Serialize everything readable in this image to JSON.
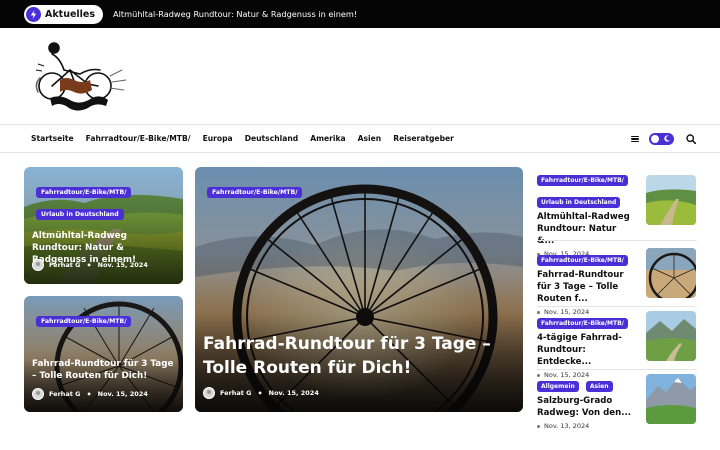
{
  "ticker": {
    "label": "Aktuelles",
    "headline": "Altmühltal-Radweg Rundtour: Natur & Radgenuss in einem!"
  },
  "nav": {
    "items": [
      "Startseite",
      "Fahrradtour/E-Bike/MTB/",
      "Europa",
      "Deutschland",
      "Amerika",
      "Asien",
      "Reiseratgeber"
    ]
  },
  "colors": {
    "accent": "#4b2fd6",
    "ticker_bg": "#050505"
  },
  "cards": [
    {
      "tags": [
        "Fahrradtour/E-Bike/MTB/",
        "Urlaub in Deutschland"
      ],
      "title": "Altmühltal-Radweg Rundtour: Natur & Radgenuss in einem!",
      "author": "Ferhat G",
      "date": "Nov. 15, 2024"
    },
    {
      "tags": [
        "Fahrradtour/E-Bike/MTB/"
      ],
      "title": "Fahrrad-Rundtour für 3 Tage – Tolle Routen für Dich!",
      "author": "Ferhat G",
      "date": "Nov. 15, 2024"
    },
    {
      "tags": [
        "Fahrradtour/E-Bike/MTB/"
      ],
      "title": "Fahrrad-Rundtour für 3 Tage – Tolle Routen für Dich!",
      "author": "Ferhat G",
      "date": "Nov. 15, 2024"
    }
  ],
  "sidebar": [
    {
      "tags": [
        "Fahrradtour/E-Bike/MTB/",
        "Urlaub in Deutschland"
      ],
      "title": "Altmühltal-Radweg Rundtour: Natur &...",
      "date": "Nov. 15, 2024"
    },
    {
      "tags": [
        "Fahrradtour/E-Bike/MTB/"
      ],
      "title": "Fahrrad-Rundtour für 3 Tage – Tolle Routen f...",
      "date": "Nov. 15, 2024"
    },
    {
      "tags": [
        "Fahrradtour/E-Bike/MTB/"
      ],
      "title": "4-tägige Fahrrad-Rundtour: Entdecke...",
      "date": "Nov. 15, 2024"
    },
    {
      "tags": [
        "Allgemein",
        "Asien"
      ],
      "title": "Salzburg-Grado Radweg: Von den...",
      "date": "Nov. 13, 2024"
    }
  ]
}
